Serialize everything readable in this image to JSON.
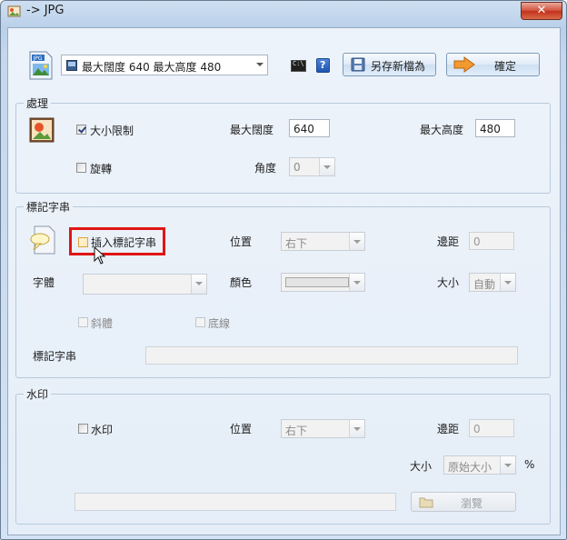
{
  "window": {
    "title": "-> JPG",
    "close_glyph": "✕"
  },
  "toolbar": {
    "preset_value": "最大闊度 640 最大高度 480",
    "save_as_label": "另存新檔為",
    "confirm_label": "確定",
    "help_glyph": "?",
    "cmd_glyph": "C:\\"
  },
  "processing": {
    "title": "處理",
    "size_limit_label": "大小限制",
    "size_limit_checked": true,
    "max_width_label": "最大闊度",
    "max_width_value": "640",
    "max_height_label": "最大高度",
    "max_height_value": "480",
    "rotate_label": "旋轉",
    "rotate_checked": false,
    "angle_label": "角度",
    "angle_value": "0"
  },
  "marker": {
    "title": "標記字串",
    "insert_label": "插入標記字串",
    "insert_checked": false,
    "position_label": "位置",
    "position_value": "右下",
    "margin_label": "邊距",
    "margin_value": "0",
    "font_label": "字體",
    "font_value": "",
    "color_label": "顏色",
    "size_label": "大小",
    "size_value": "自動",
    "italic_label": "斜體",
    "underline_label": "底線",
    "text_label": "標記字串",
    "text_value": ""
  },
  "watermark": {
    "title": "水印",
    "watermark_label": "水印",
    "watermark_checked": false,
    "position_label": "位置",
    "position_value": "右下",
    "margin_label": "邊距",
    "margin_value": "0",
    "size_label": "大小",
    "size_value": "原始大小",
    "percent_label": "%",
    "path_value": "",
    "browse_label": "瀏覽"
  },
  "colors": {
    "highlight": "#e01515",
    "accent_orange": "#f0a030",
    "window_frame": "#c4d7ee"
  }
}
